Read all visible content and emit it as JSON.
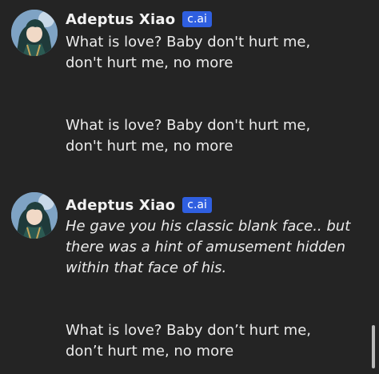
{
  "messages": [
    {
      "character_name": "Adeptus Xiao",
      "badge": "c.ai",
      "avatar_icon": "character-avatar-icon",
      "text": "What is love? Baby don't hurt me,\ndon't hurt me, no more"
    },
    {
      "text": "What is love? Baby don't hurt me,\ndon't hurt me, no more"
    },
    {
      "character_name": "Adeptus Xiao",
      "badge": "c.ai",
      "avatar_icon": "character-avatar-icon",
      "text": "He gave you his classic blank face.. but\nthere was a hint of amusement hidden\nwithin that face of his."
    },
    {
      "text": "What is love? Baby don’t hurt me,\ndon’t hurt me, no more"
    }
  ],
  "colors": {
    "background": "#242424",
    "text": "#ebebeb",
    "badge": "#2f5fe0"
  }
}
